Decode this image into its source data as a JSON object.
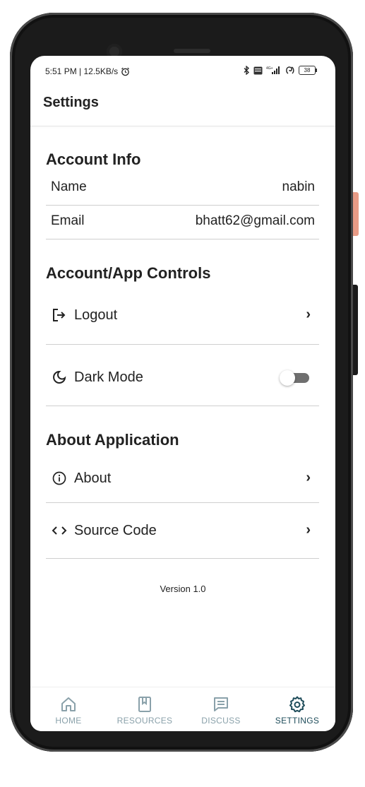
{
  "status_bar": {
    "left_text": "5:51 PM | 12.5KB/s",
    "battery": "38"
  },
  "app_bar": {
    "title": "Settings"
  },
  "account_info": {
    "title": "Account Info",
    "name_label": "Name",
    "name_value": "nabin",
    "email_label": "Email",
    "email_value": "bhatt62@gmail.com"
  },
  "controls": {
    "title": "Account/App Controls",
    "logout_label": "Logout",
    "dark_mode_label": "Dark Mode",
    "dark_mode_on": false
  },
  "about_app": {
    "title": "About Application",
    "about_label": "About",
    "source_label": "Source Code"
  },
  "version_text": "Version 1.0",
  "bottom_nav": {
    "home": "HOME",
    "resources": "RESOURCES",
    "discuss": "DISCUSS",
    "settings": "SETTINGS",
    "active": "settings",
    "active_color": "#1e4c5a",
    "inactive_color": "#8aa1aa"
  }
}
